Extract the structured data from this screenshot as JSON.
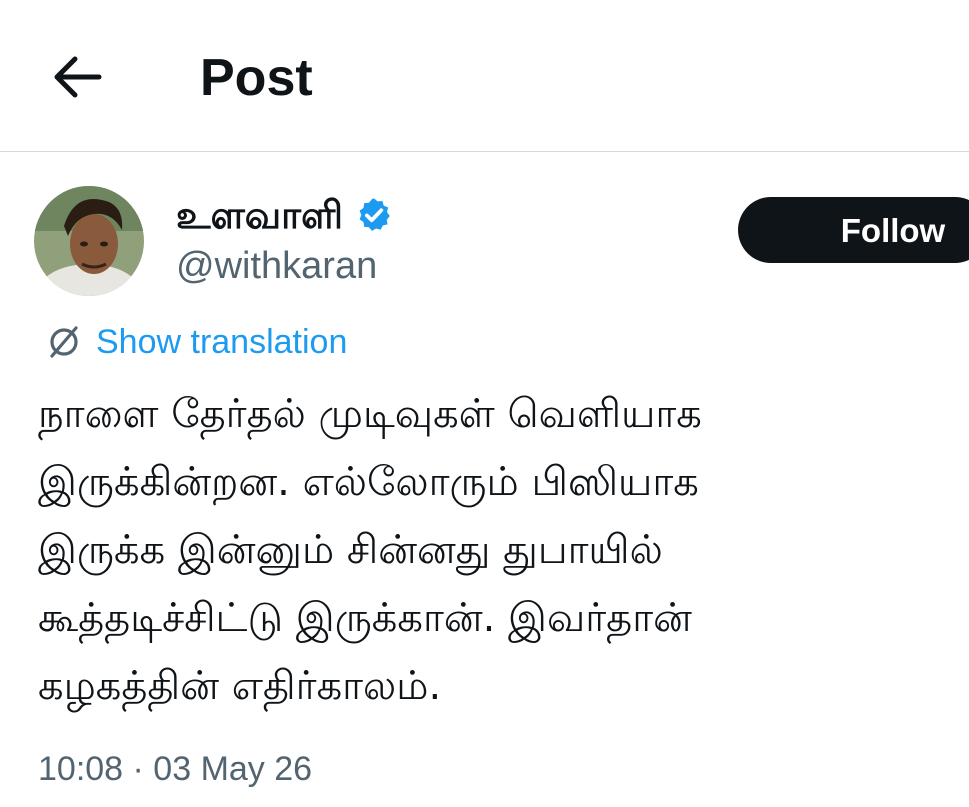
{
  "header": {
    "back_icon": "arrow-left-icon",
    "title": "Post"
  },
  "author": {
    "display_name": "உளவாளி",
    "verified_icon": "verified-badge-icon",
    "verified_color": "#1d9bf0",
    "handle": "@withkaran",
    "avatar_icon": "profile-photo"
  },
  "follow_button": {
    "label": "Follow",
    "background": "#0f1419"
  },
  "translation": {
    "icon": "globe-slash-icon",
    "label": "Show translation",
    "color": "#1d9bf0"
  },
  "post": {
    "lines": [
      "நாளை தேர்தல் முடிவுகள் வெளியாக",
      "இருக்கின்றன. எல்லோரும் பிஸியாக",
      "இருக்க இன்னும் சின்னது துபாயில்",
      "கூத்தடிச்சிட்டு இருக்கான். இவர்தான்",
      "கழகத்தின் எதிர்காலம்."
    ],
    "timestamp": "10:08 · 03 May 26"
  }
}
